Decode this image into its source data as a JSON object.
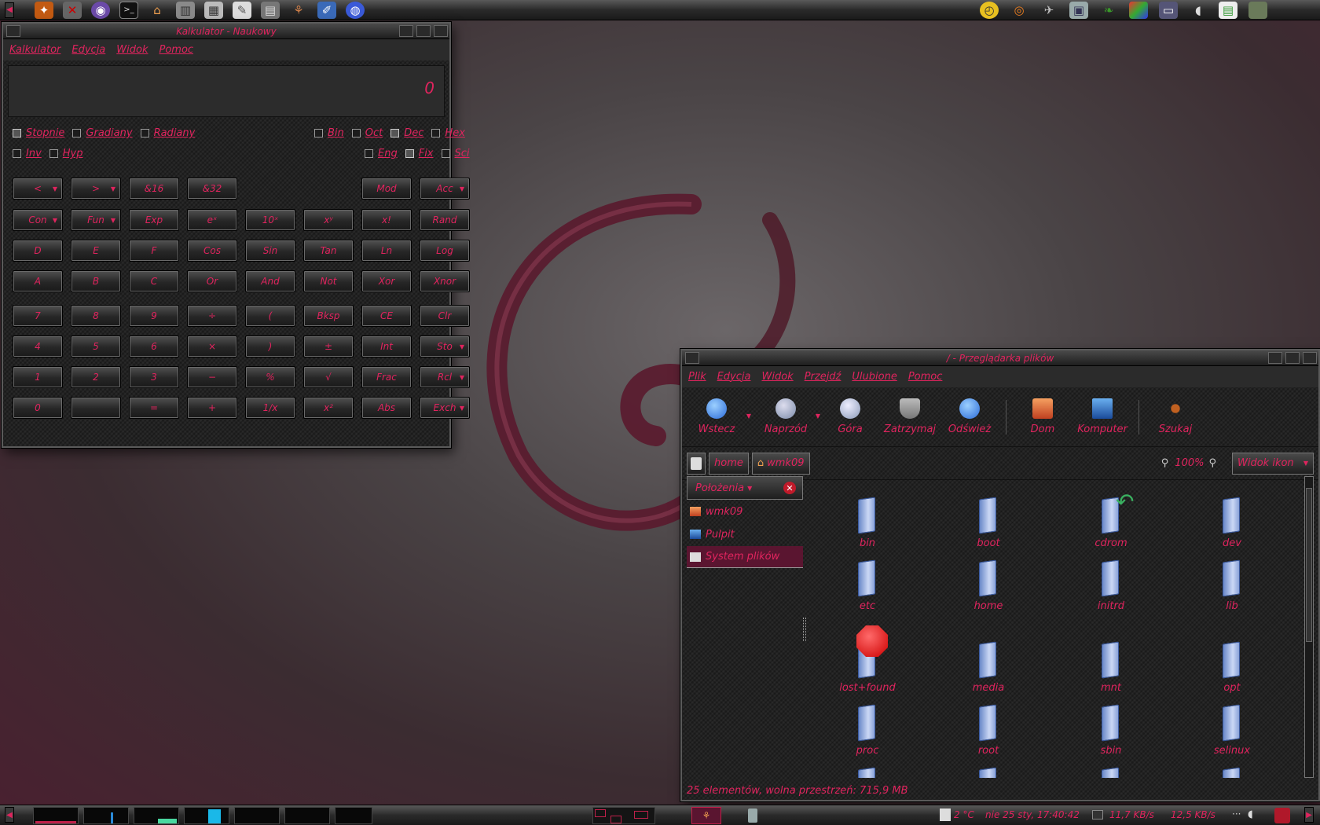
{
  "colors": {
    "accent": "#e0245e",
    "selected": "#5a1530",
    "panel": "#2a2a2a"
  },
  "top_panel": {
    "launchers": [
      "kde-menu-icon",
      "kill-icon",
      "orb-icon",
      "terminal-icon",
      "home-icon",
      "trash-icon",
      "calculator-icon",
      "editor-icon",
      "network-icon",
      "package-icon",
      "writer-icon",
      "browser-icon"
    ],
    "tray": [
      "clock-icon",
      "blender-icon",
      "wing-icon",
      "archive-icon",
      "leaf-icon",
      "cube-icon",
      "monitor-icon",
      "mouse-icon",
      "table-icon",
      "screen-icon"
    ]
  },
  "calculator": {
    "title": "Kalkulator - Naukowy",
    "menu": [
      "Kalkulator",
      "Edycja",
      "Widok",
      "Pomoc"
    ],
    "display": "0",
    "angle_options": [
      {
        "label": "Stopnie",
        "checked": true
      },
      {
        "label": "Gradiany",
        "checked": false
      },
      {
        "label": "Radiany",
        "checked": false
      }
    ],
    "base_options": [
      {
        "label": "Bin",
        "checked": false
      },
      {
        "label": "Oct",
        "checked": false
      },
      {
        "label": "Dec",
        "checked": true
      },
      {
        "label": "Hex",
        "checked": false
      }
    ],
    "inv_options": [
      {
        "label": "Inv",
        "checked": false
      },
      {
        "label": "Hyp",
        "checked": false
      }
    ],
    "format_options": [
      {
        "label": "Eng",
        "checked": false
      },
      {
        "label": "Fix",
        "checked": true
      },
      {
        "label": "Sci",
        "checked": false
      }
    ],
    "rows": [
      [
        "<",
        ">",
        "&16",
        "&32",
        "",
        "",
        "Mod",
        "Acc"
      ],
      [
        "Con",
        "Fun",
        "Exp",
        "eˣ",
        "10ˣ",
        "xʸ",
        "x!",
        "Rand"
      ],
      [
        "D",
        "E",
        "F",
        "Cos",
        "Sin",
        "Tan",
        "Ln",
        "Log"
      ],
      [
        "A",
        "B",
        "C",
        "Or",
        "And",
        "Not",
        "Xor",
        "Xnor"
      ],
      [
        "7",
        "8",
        "9",
        "÷",
        "(",
        "Bksp",
        "CE",
        "Clr"
      ],
      [
        "4",
        "5",
        "6",
        "×",
        ")",
        "±",
        "Int",
        "Sto"
      ],
      [
        "1",
        "2",
        "3",
        "−",
        "%",
        "√",
        "Frac",
        "Rcl"
      ],
      [
        "0",
        "",
        "=",
        "+",
        "1/x",
        "x²",
        "Abs",
        "Exch"
      ]
    ],
    "dropdown_buttons": [
      "<",
      ">",
      "Con",
      "Fun",
      "Acc",
      "Sto",
      "Rcl",
      "Exch"
    ]
  },
  "filemanager": {
    "title": "/ - Przeglądarka plików",
    "menu": [
      "Plik",
      "Edycja",
      "Widok",
      "Przejdź",
      "Ulubione",
      "Pomoc"
    ],
    "toolbar": {
      "back": "Wstecz",
      "forward": "Naprzód",
      "up": "Góra",
      "stop": "Zatrzymaj",
      "reload": "Odśwież",
      "home": "Dom",
      "computer": "Komputer",
      "search": "Szukaj"
    },
    "path": [
      "home",
      "wmk09"
    ],
    "zoom": "100%",
    "view_mode": "Widok ikon",
    "sidebar_title": "Położenia",
    "places": [
      {
        "label": "wmk09",
        "icon": "home-icon"
      },
      {
        "label": "Pulpit",
        "icon": "desktop-icon"
      },
      {
        "label": "System plików",
        "icon": "drive-icon"
      }
    ],
    "files": [
      "bin",
      "boot",
      "cdrom",
      "dev",
      "etc",
      "home",
      "initrd",
      "lib",
      "lost+found",
      "media",
      "mnt",
      "opt",
      "proc",
      "root",
      "sbin",
      "selinux",
      "",
      "",
      "",
      ""
    ],
    "status": "25 elementów, wolna przestrzeń: 715,9 MB"
  },
  "bottom_panel": {
    "temperature": "2 °C",
    "datetime": "nie 25 sty, 17:40:42",
    "down_rate": "11,7 KB/s",
    "up_rate": "12,5 KB/s"
  }
}
